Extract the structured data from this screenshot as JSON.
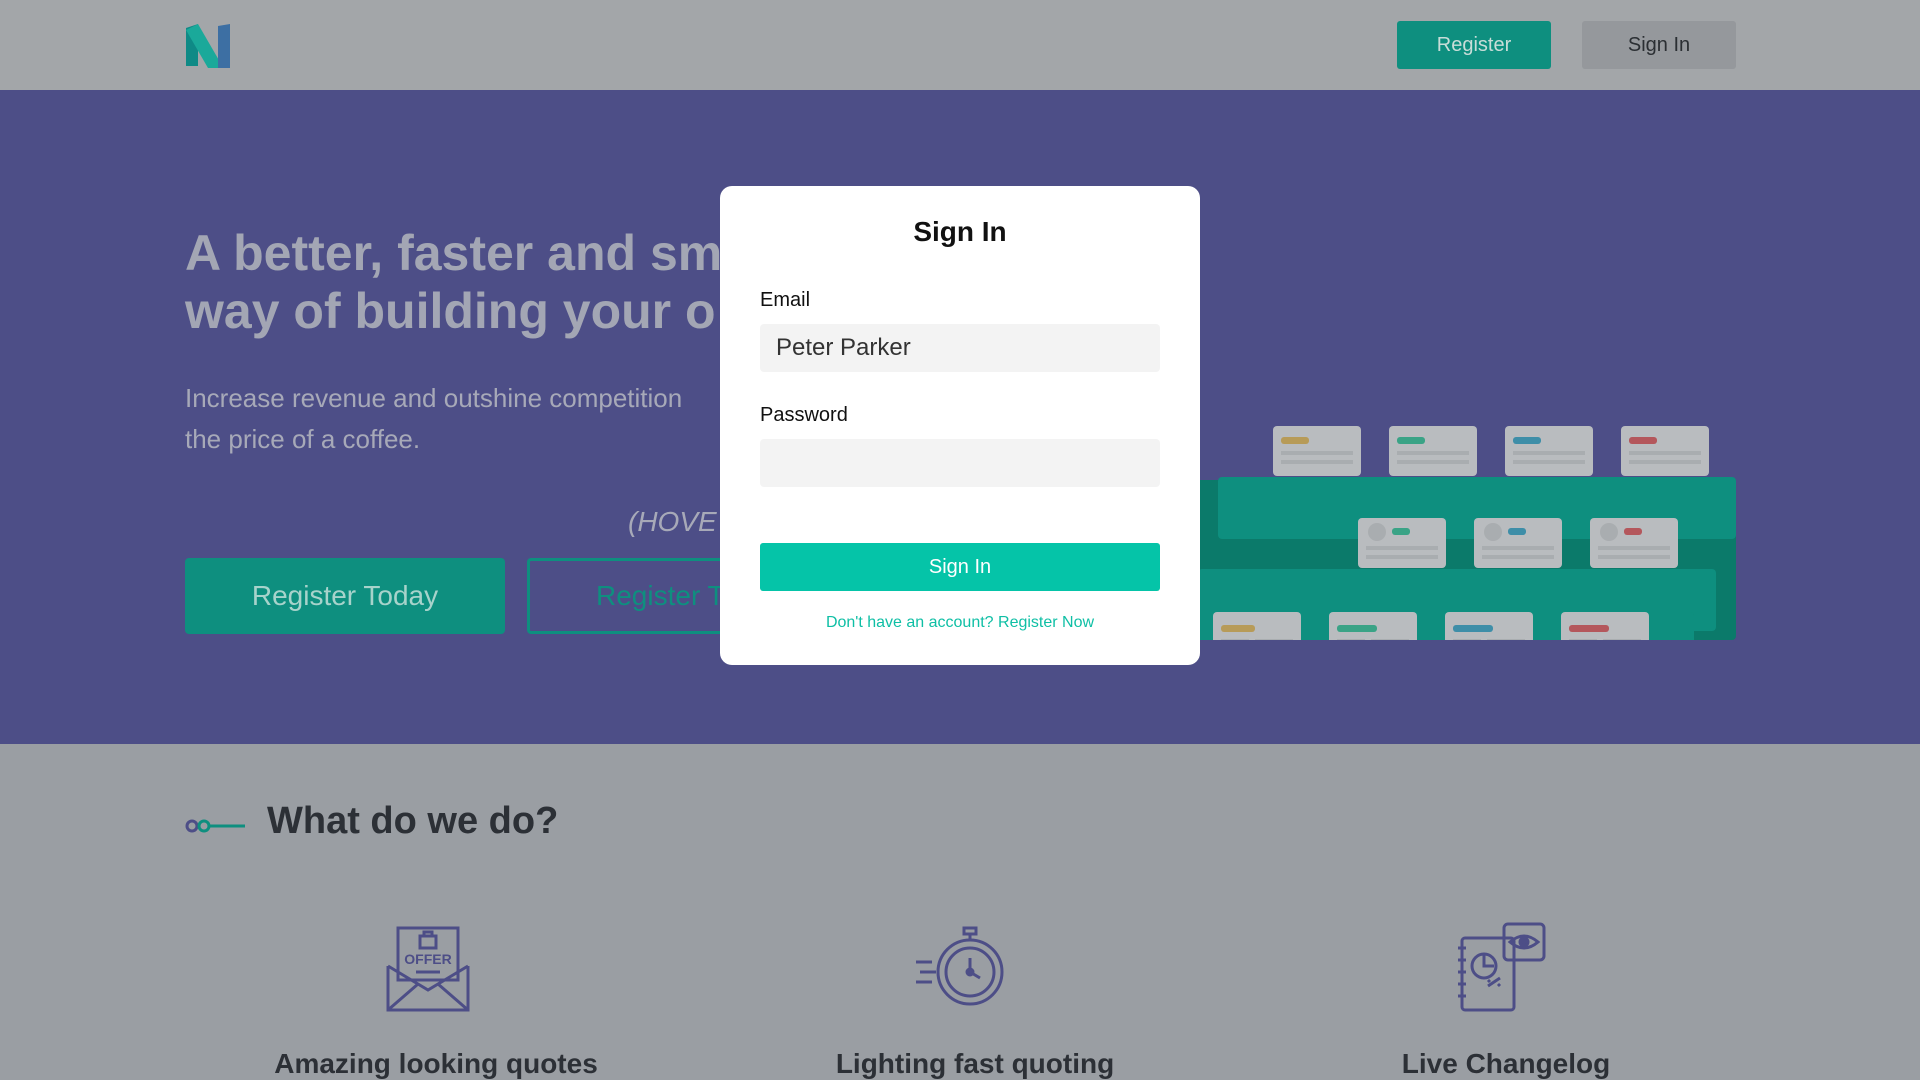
{
  "header": {
    "logo": "brand-logo",
    "register_label": "Register",
    "signin_label": "Sign In"
  },
  "hero": {
    "title_line1": "A better, faster and sm",
    "title_line2": "way of building your o",
    "subtitle_line1": "Increase revenue and outshine competition",
    "subtitle_line2": "the price of a coffee.",
    "hover_hint": "(HOVE",
    "cta_primary": "Register Today",
    "cta_secondary": "Register T"
  },
  "section": {
    "title": "What do we do?",
    "features": [
      {
        "icon": "offer-envelope-icon",
        "title": "Amazing looking quotes"
      },
      {
        "icon": "stopwatch-icon",
        "title": "Lighting fast quoting"
      },
      {
        "icon": "changelog-eye-icon",
        "title": "Live Changelog"
      }
    ]
  },
  "modal": {
    "title": "Sign In",
    "email_label": "Email",
    "email_value": "Peter Parker",
    "password_label": "Password",
    "password_value": "",
    "submit_label": "Sign In",
    "register_link": "Don't have an account? Register Now"
  },
  "colors": {
    "brand_teal": "#0e8f7f",
    "accent_teal": "#05c4a8",
    "hero_purple": "#4d4e87",
    "overlay_gray": "#a3a6a9"
  }
}
